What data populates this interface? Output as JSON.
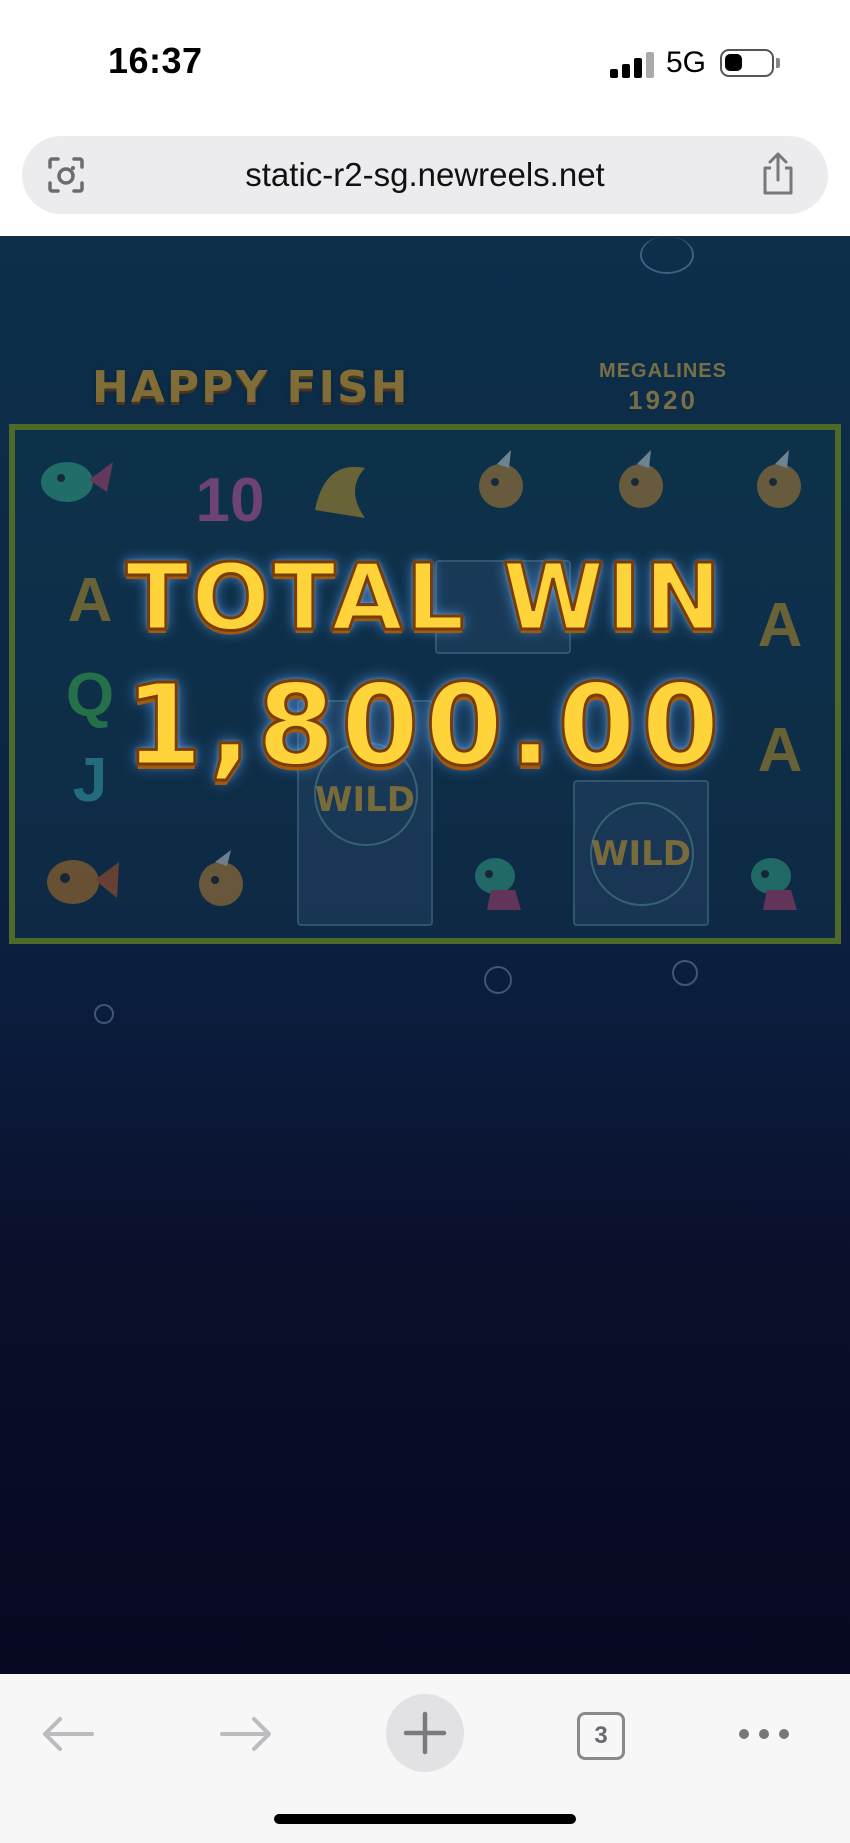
{
  "status_bar": {
    "time": "16:37",
    "network": "5G",
    "signal_icon": "signal-bars-icon",
    "battery_icon": "battery-icon",
    "battery_level": 0.3
  },
  "browser": {
    "url": "static-r2-sg.newreels.net",
    "lens_icon": "camera-lens-icon",
    "share_icon": "share-icon",
    "open_tabs_count": "3"
  },
  "game": {
    "title": "HAPPY FISH",
    "megalines_label": "MEGALINES",
    "megalines_value": "1920",
    "symbols": {
      "col1": [
        "",
        "A",
        "Q",
        "J",
        ""
      ],
      "col2": [
        "10",
        "",
        "",
        "",
        ""
      ],
      "col6": [
        "",
        "A",
        "A",
        ""
      ]
    },
    "wild_label": "WILD",
    "win_title": "TOTAL WIN",
    "win_amount": "1,800.00"
  },
  "colors": {
    "win_text": "#ffd43a",
    "game_bg_top": "#0d2f4a",
    "game_bg_bottom": "#070822"
  }
}
